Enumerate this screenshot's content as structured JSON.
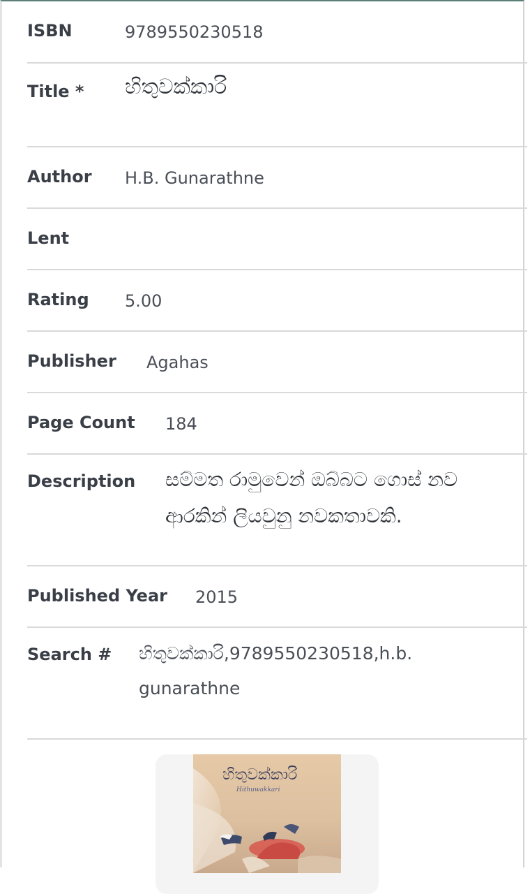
{
  "fields": {
    "isbn": {
      "label": "ISBN",
      "value": "9789550230518"
    },
    "title": {
      "label": "Title *",
      "value": "හිතුවක්කාරි"
    },
    "author": {
      "label": "Author",
      "value": "H.B. Gunarathne"
    },
    "lent": {
      "label": "Lent",
      "value": ""
    },
    "rating": {
      "label": "Rating",
      "value": "5.00"
    },
    "publisher": {
      "label": "Publisher",
      "value": "Agahas"
    },
    "page_count": {
      "label": "Page Count",
      "value": "184"
    },
    "description": {
      "label": "Description",
      "value": "සම්මත රාමුවෙන් ඔබ්බට ගොස් නව ආරකින් ලියවුනු නවකතාවකි."
    },
    "published_year": {
      "label": "Published Year",
      "value": "2015"
    },
    "search": {
      "label": "Search #",
      "value": "හිතුවක්කාරි,9789550230518,h.b. gunarathne"
    }
  },
  "cover": {
    "title_text": "හිතුවක්කාරි",
    "subtitle_text": "Hithuwakkari"
  },
  "colors": {
    "top_border": "#5c7f78",
    "divider": "#d9d9d9",
    "label": "#3a3f47",
    "value": "#4a4f57"
  }
}
